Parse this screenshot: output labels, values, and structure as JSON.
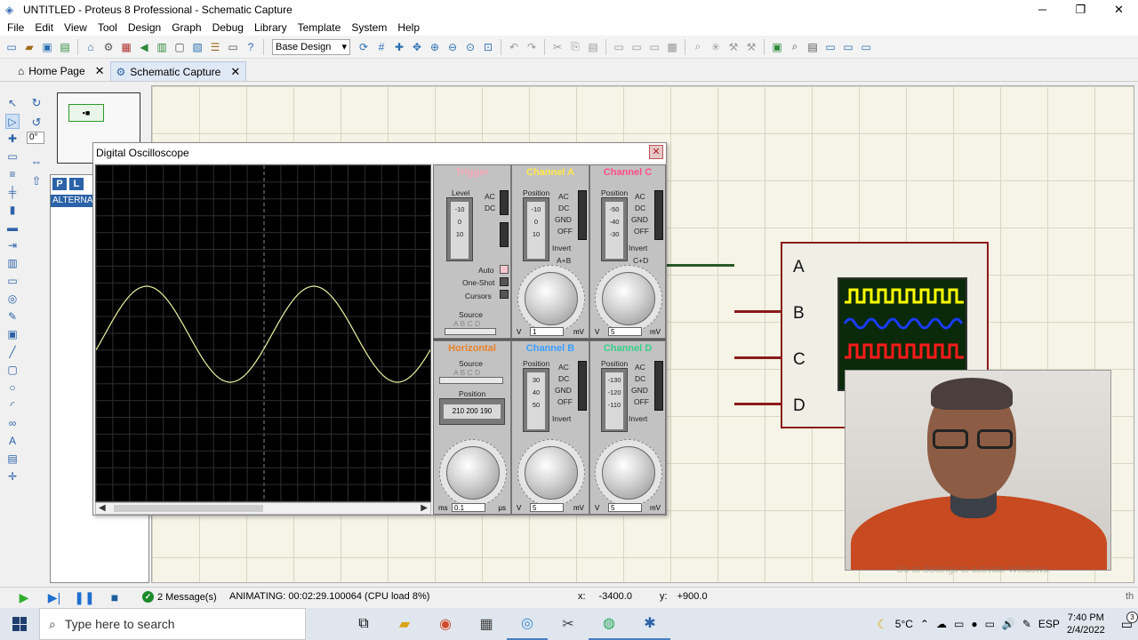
{
  "window": {
    "title": "UNTITLED - Proteus 8 Professional - Schematic Capture",
    "controls": [
      "─",
      "❐",
      "✕"
    ]
  },
  "menu": [
    "File",
    "Edit",
    "View",
    "Tool",
    "Design",
    "Graph",
    "Debug",
    "Library",
    "Template",
    "System",
    "Help"
  ],
  "toolbar": {
    "design_select": "Base Design"
  },
  "tabs": [
    {
      "label": "Home Page",
      "icon": "home-icon"
    },
    {
      "label": "Schematic Capture",
      "icon": "schematic-icon"
    }
  ],
  "left_panel": {
    "angle_value": "0°",
    "p_button": "P",
    "l_button": "L",
    "device_item": "ALTERNATOR"
  },
  "oscilloscope": {
    "title": "Digital Oscilloscope",
    "trigger": {
      "header": "Trigger",
      "level_label": "Level",
      "ac": "AC",
      "dc": "DC",
      "scale": [
        "-10",
        "0",
        "10"
      ],
      "auto": "Auto",
      "one_shot": "One-Shot",
      "cursors": "Cursors",
      "source_label": "Source",
      "source_letters": "A B C D"
    },
    "horizontal": {
      "header": "Horizontal",
      "source_label": "Source",
      "source_letters": "A B C D",
      "position_label": "Position",
      "position_scale": "210 200 190",
      "unit_left": "ms",
      "value": "0.1",
      "unit_right": "μs"
    },
    "channel_a": {
      "header": "Channel A",
      "header_color": "#ffe84a",
      "position_label": "Position",
      "modes": [
        "AC",
        "DC",
        "GND",
        "OFF"
      ],
      "invert": "Invert",
      "combine": "A+B",
      "scale": [
        "-10",
        "0",
        "10"
      ],
      "unit_left": "V",
      "value": "1",
      "unit_right": "mV"
    },
    "channel_b": {
      "header": "Channel B",
      "header_color": "#3aa0ff",
      "position_label": "Position",
      "modes": [
        "AC",
        "DC",
        "GND",
        "OFF"
      ],
      "invert": "Invert",
      "scale": [
        "30",
        "40",
        "50"
      ],
      "unit_left": "V",
      "value": "5",
      "unit_right": "mV"
    },
    "channel_c": {
      "header": "Channel C",
      "header_color": "#ff4d8a",
      "position_label": "Position",
      "modes": [
        "AC",
        "DC",
        "GND",
        "OFF"
      ],
      "invert": "Invert",
      "combine": "C+D",
      "scale": [
        "-50",
        "-40",
        "-30"
      ],
      "unit_left": "V",
      "value": "5",
      "unit_right": "mV"
    },
    "channel_d": {
      "header": "Channel D",
      "header_color": "#35d08a",
      "position_label": "Position",
      "modes": [
        "AC",
        "DC",
        "GND",
        "OFF"
      ],
      "invert": "Invert",
      "scale": [
        "-130",
        "-120",
        "-110"
      ],
      "unit_left": "V",
      "value": "5",
      "unit_right": "mV"
    },
    "trace_color": "#e9f2a0"
  },
  "schematic_component": {
    "pins": [
      "A",
      "B",
      "C",
      "D"
    ],
    "wire_color": "#8b1a1a",
    "trace_colors": [
      "#ffff00",
      "#1a3cff",
      "#ff1a1a",
      "#22cc22"
    ]
  },
  "status": {
    "message_count": "2 Message(s)",
    "animating": "ANIMATING: 00:02:29.100064 (CPU load 8%)",
    "x_label": "x:",
    "x_value": "-3400.0",
    "y_label": "y:",
    "y_value": "+900.0",
    "right_text": "th"
  },
  "webcam_watermark": "Go to Settings to activate Windows.",
  "taskbar": {
    "search_placeholder": "Type here to search",
    "weather": "5°C",
    "language": "ESP",
    "time": "7:40 PM",
    "date": "2/4/2022",
    "notification_count": "3"
  }
}
